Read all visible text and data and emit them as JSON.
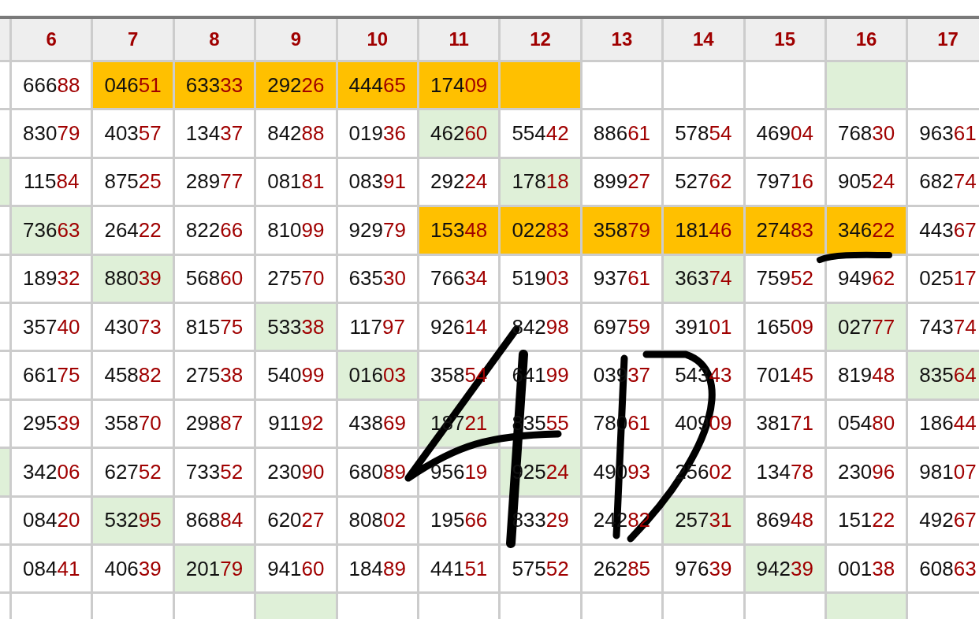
{
  "table": {
    "columns": [
      "",
      "6",
      "7",
      "8",
      "9",
      "10",
      "11",
      "12",
      "13",
      "14",
      "15",
      "16",
      "17"
    ],
    "rows": [
      {
        "cells": [
          {
            "kind": "plain"
          },
          {
            "lead": "666",
            "tail": "88",
            "kind": "plain"
          },
          {
            "lead": "046",
            "tail": "51",
            "kind": "orange"
          },
          {
            "lead": "633",
            "tail": "33",
            "kind": "orange"
          },
          {
            "lead": "292",
            "tail": "26",
            "kind": "orange"
          },
          {
            "lead": "444",
            "tail": "65",
            "kind": "orange"
          },
          {
            "lead": "174",
            "tail": "09",
            "kind": "orange"
          },
          {
            "kind": "orange"
          },
          {
            "kind": "plain"
          },
          {
            "kind": "plain"
          },
          {
            "kind": "plain"
          },
          {
            "kind": "green"
          },
          {
            "kind": "plain"
          }
        ]
      },
      {
        "cells": [
          {
            "kind": "plain"
          },
          {
            "lead": "830",
            "tail": "79",
            "kind": "plain"
          },
          {
            "lead": "403",
            "tail": "57",
            "kind": "plain"
          },
          {
            "lead": "134",
            "tail": "37",
            "kind": "plain"
          },
          {
            "lead": "842",
            "tail": "88",
            "kind": "plain"
          },
          {
            "lead": "019",
            "tail": "36",
            "kind": "plain"
          },
          {
            "lead": "462",
            "tail": "60",
            "kind": "green"
          },
          {
            "lead": "554",
            "tail": "42",
            "kind": "plain"
          },
          {
            "lead": "886",
            "tail": "61",
            "kind": "plain"
          },
          {
            "lead": "578",
            "tail": "54",
            "kind": "plain"
          },
          {
            "lead": "469",
            "tail": "04",
            "kind": "plain"
          },
          {
            "lead": "768",
            "tail": "30",
            "kind": "plain"
          },
          {
            "lead": "963",
            "tail": "61",
            "kind": "plain"
          }
        ]
      },
      {
        "cells": [
          {
            "kind": "green"
          },
          {
            "lead": "115",
            "tail": "84",
            "kind": "plain"
          },
          {
            "lead": "875",
            "tail": "25",
            "kind": "plain"
          },
          {
            "lead": "289",
            "tail": "77",
            "kind": "plain"
          },
          {
            "lead": "081",
            "tail": "81",
            "kind": "plain"
          },
          {
            "lead": "083",
            "tail": "91",
            "kind": "plain"
          },
          {
            "lead": "292",
            "tail": "24",
            "kind": "plain"
          },
          {
            "lead": "178",
            "tail": "18",
            "kind": "green"
          },
          {
            "lead": "899",
            "tail": "27",
            "kind": "plain"
          },
          {
            "lead": "527",
            "tail": "62",
            "kind": "plain"
          },
          {
            "lead": "797",
            "tail": "16",
            "kind": "plain"
          },
          {
            "lead": "905",
            "tail": "24",
            "kind": "plain"
          },
          {
            "lead": "682",
            "tail": "74",
            "kind": "plain"
          }
        ]
      },
      {
        "cells": [
          {
            "kind": "plain"
          },
          {
            "lead": "736",
            "tail": "63",
            "kind": "green"
          },
          {
            "lead": "264",
            "tail": "22",
            "kind": "plain"
          },
          {
            "lead": "822",
            "tail": "66",
            "kind": "plain"
          },
          {
            "lead": "810",
            "tail": "99",
            "kind": "plain"
          },
          {
            "lead": "929",
            "tail": "79",
            "kind": "plain"
          },
          {
            "lead": "153",
            "tail": "48",
            "kind": "orange"
          },
          {
            "lead": "022",
            "tail": "83",
            "kind": "orange"
          },
          {
            "lead": "358",
            "tail": "79",
            "kind": "orange"
          },
          {
            "lead": "181",
            "tail": "46",
            "kind": "orange"
          },
          {
            "lead": "274",
            "tail": "83",
            "kind": "orange"
          },
          {
            "lead": "346",
            "tail": "22",
            "kind": "orange"
          },
          {
            "lead": "443",
            "tail": "67",
            "kind": "plain"
          }
        ]
      },
      {
        "cells": [
          {
            "kind": "plain"
          },
          {
            "lead": "189",
            "tail": "32",
            "kind": "plain"
          },
          {
            "lead": "880",
            "tail": "39",
            "kind": "green"
          },
          {
            "lead": "568",
            "tail": "60",
            "kind": "plain"
          },
          {
            "lead": "275",
            "tail": "70",
            "kind": "plain"
          },
          {
            "lead": "635",
            "tail": "30",
            "kind": "plain"
          },
          {
            "lead": "766",
            "tail": "34",
            "kind": "plain"
          },
          {
            "lead": "519",
            "tail": "03",
            "kind": "plain"
          },
          {
            "lead": "937",
            "tail": "61",
            "kind": "plain"
          },
          {
            "lead": "363",
            "tail": "74",
            "kind": "green"
          },
          {
            "lead": "759",
            "tail": "52",
            "kind": "plain"
          },
          {
            "lead": "949",
            "tail": "62",
            "kind": "plain"
          },
          {
            "lead": "025",
            "tail": "17",
            "kind": "plain"
          }
        ]
      },
      {
        "cells": [
          {
            "kind": "plain"
          },
          {
            "lead": "357",
            "tail": "40",
            "kind": "plain"
          },
          {
            "lead": "430",
            "tail": "73",
            "kind": "plain"
          },
          {
            "lead": "815",
            "tail": "75",
            "kind": "plain"
          },
          {
            "lead": "533",
            "tail": "38",
            "kind": "green"
          },
          {
            "lead": "117",
            "tail": "97",
            "kind": "plain"
          },
          {
            "lead": "926",
            "tail": "14",
            "kind": "plain"
          },
          {
            "lead": "842",
            "tail": "98",
            "kind": "plain"
          },
          {
            "lead": "697",
            "tail": "59",
            "kind": "plain"
          },
          {
            "lead": "391",
            "tail": "01",
            "kind": "plain"
          },
          {
            "lead": "165",
            "tail": "09",
            "kind": "plain"
          },
          {
            "lead": "027",
            "tail": "77",
            "kind": "green"
          },
          {
            "lead": "743",
            "tail": "74",
            "kind": "plain"
          }
        ]
      },
      {
        "cells": [
          {
            "kind": "plain"
          },
          {
            "lead": "661",
            "tail": "75",
            "kind": "plain"
          },
          {
            "lead": "458",
            "tail": "82",
            "kind": "plain"
          },
          {
            "lead": "275",
            "tail": "38",
            "kind": "plain"
          },
          {
            "lead": "540",
            "tail": "99",
            "kind": "plain"
          },
          {
            "lead": "016",
            "tail": "03",
            "kind": "green"
          },
          {
            "lead": "358",
            "tail": "54",
            "kind": "plain"
          },
          {
            "lead": "641",
            "tail": "99",
            "kind": "plain"
          },
          {
            "lead": "039",
            "tail": "37",
            "kind": "plain"
          },
          {
            "lead": "543",
            "tail": "43",
            "kind": "plain"
          },
          {
            "lead": "701",
            "tail": "45",
            "kind": "plain"
          },
          {
            "lead": "819",
            "tail": "48",
            "kind": "plain"
          },
          {
            "lead": "835",
            "tail": "64",
            "kind": "green"
          }
        ]
      },
      {
        "cells": [
          {
            "kind": "plain"
          },
          {
            "lead": "295",
            "tail": "39",
            "kind": "plain"
          },
          {
            "lead": "358",
            "tail": "70",
            "kind": "plain"
          },
          {
            "lead": "298",
            "tail": "87",
            "kind": "plain"
          },
          {
            "lead": "911",
            "tail": "92",
            "kind": "plain"
          },
          {
            "lead": "438",
            "tail": "69",
            "kind": "plain"
          },
          {
            "lead": "187",
            "tail": "21",
            "kind": "green"
          },
          {
            "lead": "835",
            "tail": "55",
            "kind": "plain"
          },
          {
            "lead": "780",
            "tail": "61",
            "kind": "plain"
          },
          {
            "lead": "409",
            "tail": "09",
            "kind": "plain"
          },
          {
            "lead": "381",
            "tail": "71",
            "kind": "plain"
          },
          {
            "lead": "054",
            "tail": "80",
            "kind": "plain"
          },
          {
            "lead": "186",
            "tail": "44",
            "kind": "plain"
          }
        ]
      },
      {
        "cells": [
          {
            "kind": "green"
          },
          {
            "lead": "342",
            "tail": "06",
            "kind": "plain"
          },
          {
            "lead": "627",
            "tail": "52",
            "kind": "plain"
          },
          {
            "lead": "733",
            "tail": "52",
            "kind": "plain"
          },
          {
            "lead": "230",
            "tail": "90",
            "kind": "plain"
          },
          {
            "lead": "680",
            "tail": "89",
            "kind": "plain"
          },
          {
            "lead": "956",
            "tail": "19",
            "kind": "plain"
          },
          {
            "lead": "925",
            "tail": "24",
            "kind": "green"
          },
          {
            "lead": "490",
            "tail": "93",
            "kind": "plain"
          },
          {
            "lead": "256",
            "tail": "02",
            "kind": "plain"
          },
          {
            "lead": "134",
            "tail": "78",
            "kind": "plain"
          },
          {
            "lead": "230",
            "tail": "96",
            "kind": "plain"
          },
          {
            "lead": "981",
            "tail": "07",
            "kind": "plain"
          }
        ]
      },
      {
        "cells": [
          {
            "kind": "plain"
          },
          {
            "lead": "084",
            "tail": "20",
            "kind": "plain"
          },
          {
            "lead": "532",
            "tail": "95",
            "kind": "green"
          },
          {
            "lead": "868",
            "tail": "84",
            "kind": "plain"
          },
          {
            "lead": "620",
            "tail": "27",
            "kind": "plain"
          },
          {
            "lead": "808",
            "tail": "02",
            "kind": "plain"
          },
          {
            "lead": "195",
            "tail": "66",
            "kind": "plain"
          },
          {
            "lead": "833",
            "tail": "29",
            "kind": "plain"
          },
          {
            "lead": "242",
            "tail": "82",
            "kind": "plain"
          },
          {
            "lead": "257",
            "tail": "31",
            "kind": "green"
          },
          {
            "lead": "869",
            "tail": "48",
            "kind": "plain"
          },
          {
            "lead": "151",
            "tail": "22",
            "kind": "plain"
          },
          {
            "lead": "492",
            "tail": "67",
            "kind": "plain"
          }
        ]
      },
      {
        "cells": [
          {
            "kind": "plain"
          },
          {
            "lead": "084",
            "tail": "41",
            "kind": "plain"
          },
          {
            "lead": "406",
            "tail": "39",
            "kind": "plain"
          },
          {
            "lead": "201",
            "tail": "79",
            "kind": "green"
          },
          {
            "lead": "941",
            "tail": "60",
            "kind": "plain"
          },
          {
            "lead": "184",
            "tail": "89",
            "kind": "plain"
          },
          {
            "lead": "441",
            "tail": "51",
            "kind": "plain"
          },
          {
            "lead": "575",
            "tail": "52",
            "kind": "plain"
          },
          {
            "lead": "262",
            "tail": "85",
            "kind": "plain"
          },
          {
            "lead": "976",
            "tail": "39",
            "kind": "plain"
          },
          {
            "lead": "942",
            "tail": "39",
            "kind": "green"
          },
          {
            "lead": "001",
            "tail": "38",
            "kind": "plain"
          },
          {
            "lead": "608",
            "tail": "63",
            "kind": "plain"
          }
        ]
      },
      {
        "cells": [
          {
            "kind": "plain"
          },
          {
            "kind": "plain"
          },
          {
            "kind": "plain"
          },
          {
            "kind": "plain"
          },
          {
            "kind": "green"
          },
          {
            "kind": "plain"
          },
          {
            "kind": "plain"
          },
          {
            "kind": "plain"
          },
          {
            "kind": "plain"
          },
          {
            "kind": "plain"
          },
          {
            "kind": "plain"
          },
          {
            "kind": "green"
          },
          {
            "kind": "plain"
          }
        ]
      }
    ]
  }
}
